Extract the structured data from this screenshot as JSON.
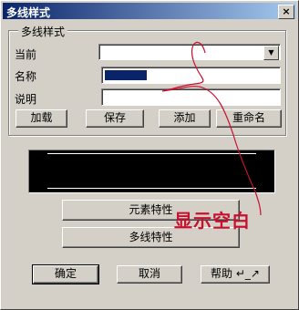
{
  "window": {
    "title": "多线样式",
    "close_glyph": "×"
  },
  "group": {
    "title": "多线样式"
  },
  "fields": {
    "current_label": "当前",
    "current_value": "",
    "name_label": "名称",
    "name_value": "",
    "desc_label": "说明",
    "desc_value": ""
  },
  "buttons": {
    "load": "加载",
    "save": "保存",
    "add": "添加",
    "rename": "重命名",
    "element_props": "元素特性",
    "multiline_props": "多线特性",
    "ok": "确定",
    "cancel": "取消",
    "help": "帮助 ↵_↗"
  },
  "annotation": {
    "text": "显示空白",
    "color": "#c8102e"
  },
  "colors": {
    "title_start": "#0a246a",
    "title_end": "#a6caf0",
    "face": "#d4d0c8",
    "preview_bg": "#000000"
  }
}
